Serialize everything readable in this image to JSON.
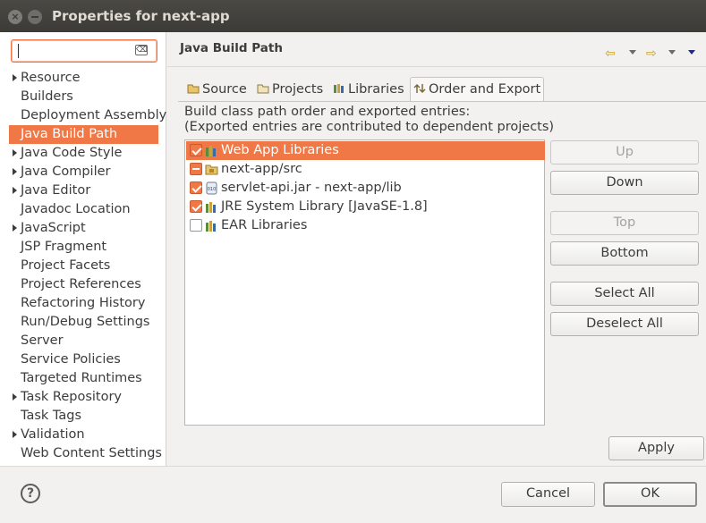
{
  "window": {
    "title": "Properties for next-app"
  },
  "filter": {
    "value": "",
    "clear_icon": "⌫"
  },
  "sidebar": {
    "items": [
      {
        "label": "Resource",
        "expandable": true
      },
      {
        "label": "Builders",
        "expandable": false
      },
      {
        "label": "Deployment Assembly",
        "expandable": false
      },
      {
        "label": "Java Build Path",
        "expandable": false,
        "selected": true
      },
      {
        "label": "Java Code Style",
        "expandable": true
      },
      {
        "label": "Java Compiler",
        "expandable": true
      },
      {
        "label": "Java Editor",
        "expandable": true
      },
      {
        "label": "Javadoc Location",
        "expandable": false
      },
      {
        "label": "JavaScript",
        "expandable": true
      },
      {
        "label": "JSP Fragment",
        "expandable": false
      },
      {
        "label": "Project Facets",
        "expandable": false
      },
      {
        "label": "Project References",
        "expandable": false
      },
      {
        "label": "Refactoring History",
        "expandable": false
      },
      {
        "label": "Run/Debug Settings",
        "expandable": false
      },
      {
        "label": "Server",
        "expandable": false
      },
      {
        "label": "Service Policies",
        "expandable": false
      },
      {
        "label": "Targeted Runtimes",
        "expandable": false
      },
      {
        "label": "Task Repository",
        "expandable": true
      },
      {
        "label": "Task Tags",
        "expandable": false
      },
      {
        "label": "Validation",
        "expandable": true
      },
      {
        "label": "Web Content Settings",
        "expandable": false
      }
    ]
  },
  "page": {
    "title": "Java Build Path",
    "nav": {
      "back_icon": "⇦",
      "forward_icon": "⇨"
    }
  },
  "tabs": [
    {
      "label": "Source",
      "icon": "source-folder-icon"
    },
    {
      "label": "Projects",
      "icon": "projects-icon"
    },
    {
      "label": "Libraries",
      "icon": "libraries-icon"
    },
    {
      "label": "Order and Export",
      "icon": "order-export-icon",
      "active": true
    }
  ],
  "order_export": {
    "description_line1": "Build class path order and exported entries:",
    "description_line2": "(Exported entries are contributed to dependent projects)",
    "entries": [
      {
        "label": "Web App Libraries",
        "state": "checked",
        "selected": true,
        "icon": "library-icon"
      },
      {
        "label": "next-app/src",
        "state": "partial",
        "selected": false,
        "icon": "package-folder-icon"
      },
      {
        "label": "servlet-api.jar - next-app/lib",
        "state": "checked",
        "selected": false,
        "icon": "jar-icon"
      },
      {
        "label": "JRE System Library [JavaSE-1.8]",
        "state": "checked",
        "selected": false,
        "icon": "library-icon"
      },
      {
        "label": "EAR Libraries",
        "state": "unchecked",
        "selected": false,
        "icon": "library-icon"
      }
    ],
    "buttons": {
      "up": "Up",
      "down": "Down",
      "top": "Top",
      "bottom": "Bottom",
      "select_all": "Select All",
      "deselect_all": "Deselect All"
    }
  },
  "footer": {
    "apply": "Apply",
    "help_icon": "?",
    "cancel": "Cancel",
    "ok": "OK"
  },
  "colors": {
    "accent": "#f07746",
    "titlebar": "#3c3b37"
  }
}
